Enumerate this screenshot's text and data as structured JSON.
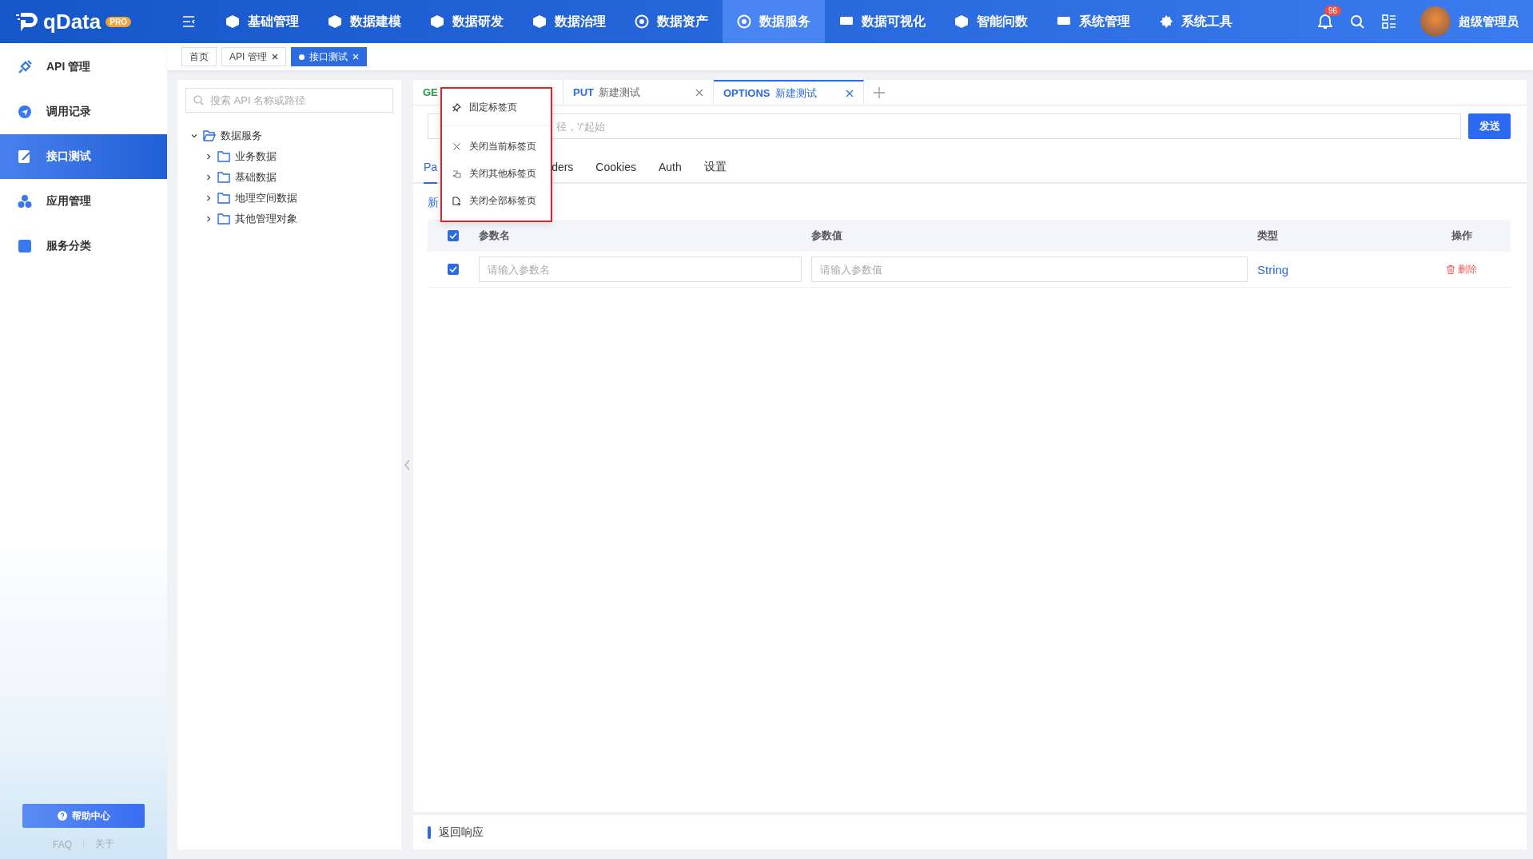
{
  "app": {
    "logo": "qData",
    "badge": "PRO"
  },
  "nav": [
    {
      "label": "基础管理",
      "selected": false
    },
    {
      "label": "数据建模",
      "selected": false
    },
    {
      "label": "数据研发",
      "selected": false
    },
    {
      "label": "数据治理",
      "selected": false
    },
    {
      "label": "数据资产",
      "selected": false
    },
    {
      "label": "数据服务",
      "selected": true
    },
    {
      "label": "数据可视化",
      "selected": false
    },
    {
      "label": "智能问数",
      "selected": false
    },
    {
      "label": "系统管理",
      "selected": false
    },
    {
      "label": "系统工具",
      "selected": false
    }
  ],
  "notifications": {
    "count": "96"
  },
  "user": {
    "name": "超级管理员"
  },
  "sidebar": {
    "items": [
      {
        "label": "API 管理",
        "selected": false
      },
      {
        "label": "调用记录",
        "selected": false
      },
      {
        "label": "接口测试",
        "selected": true
      },
      {
        "label": "应用管理",
        "selected": false
      },
      {
        "label": "服务分类",
        "selected": false
      }
    ],
    "help_button": "帮助中心",
    "links": [
      "FAQ",
      "关于"
    ]
  },
  "page_tabs": [
    {
      "label": "首页",
      "selected": false,
      "closable": false
    },
    {
      "label": "API 管理",
      "selected": false,
      "closable": true
    },
    {
      "label": "接口测试",
      "selected": true,
      "closable": true
    }
  ],
  "tree": {
    "search_placeholder": "搜索 API 名称或路径",
    "nodes": [
      {
        "label": "数据服务",
        "expanded": true,
        "children": [
          {
            "label": "业务数据",
            "expanded": false
          },
          {
            "label": "基础数据",
            "expanded": false
          },
          {
            "label": "地理空间数据",
            "expanded": false
          },
          {
            "label": "其他管理对象",
            "expanded": false
          }
        ]
      }
    ]
  },
  "request_tabs": [
    {
      "method": "GE",
      "color": "#1f9d3f",
      "selected": false,
      "closable": false
    },
    {
      "method": "PUT",
      "title": "新建测试",
      "color": "#2d6be0",
      "selected": false,
      "closable": true
    },
    {
      "method": "OPTIONS",
      "title": "新建测试",
      "color": "#2d6be0",
      "selected": true,
      "closable": true
    }
  ],
  "context_menu": {
    "items": [
      {
        "kind": "pin",
        "label": "固定标签页"
      },
      {
        "kind": "close",
        "label": "关闭当前标签页"
      },
      {
        "kind": "close-others",
        "label": "关闭其他标签页"
      },
      {
        "kind": "close-all",
        "label": "关闭全部标签页"
      }
    ]
  },
  "url_field": {
    "placeholder": "径，'/'起始"
  },
  "send_button": "发送",
  "param_tabs": [
    {
      "label": "Pa",
      "selected": true
    },
    {
      "label": "ders",
      "selected": false
    },
    {
      "label": "Cookies",
      "selected": false
    },
    {
      "label": "Auth",
      "selected": false
    },
    {
      "label": "设置",
      "selected": false
    }
  ],
  "add_button": "新",
  "params_table": {
    "all_checked": true,
    "columns": [
      "参数名",
      "参数值",
      "类型",
      "操作"
    ],
    "rows": [
      {
        "checked": true,
        "name_placeholder": "请输入参数名",
        "value_placeholder": "请输入参数值",
        "type": "String",
        "action": "删除"
      }
    ]
  },
  "response": {
    "title": "返回响应"
  }
}
